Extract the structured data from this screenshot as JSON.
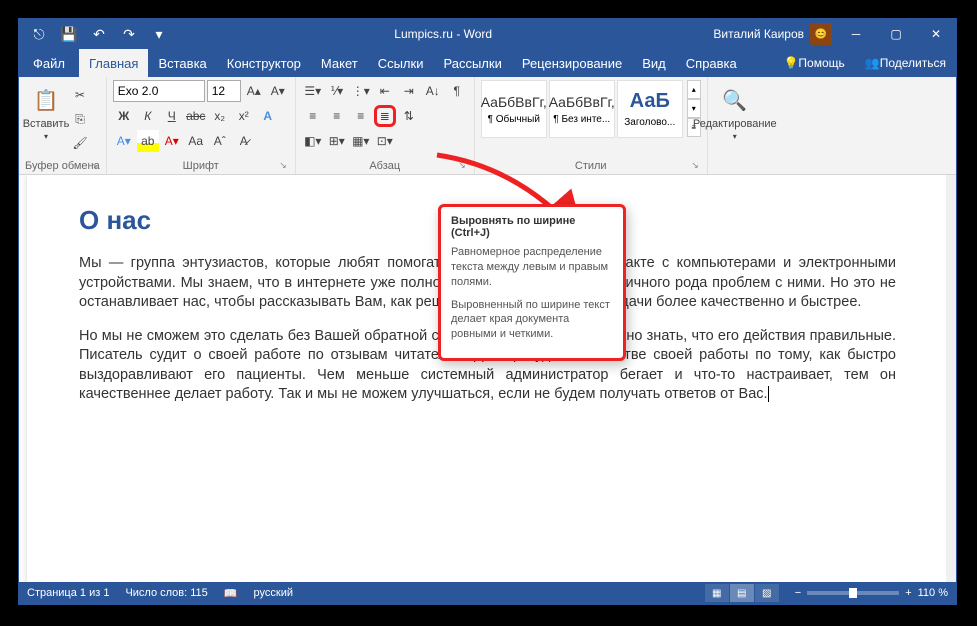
{
  "window": {
    "title": "Lumpics.ru - Word",
    "user": "Виталий Каиров"
  },
  "tabs": {
    "file": "Файл",
    "items": [
      "Главная",
      "Вставка",
      "Конструктор",
      "Макет",
      "Ссылки",
      "Рассылки",
      "Рецензирование",
      "Вид",
      "Справка"
    ],
    "help": "Помощь",
    "share": "Поделиться"
  },
  "ribbon": {
    "clipboard": {
      "label": "Буфер обмена",
      "paste": "Вставить"
    },
    "font": {
      "label": "Шрифт",
      "name": "Exo 2.0",
      "size": "12"
    },
    "paragraph": {
      "label": "Абзац"
    },
    "styles": {
      "label": "Стили",
      "items": [
        {
          "preview": "АаБбВвГг,",
          "name": "¶ Обычный"
        },
        {
          "preview": "АаБбВвГг,",
          "name": "¶ Без инте..."
        },
        {
          "preview": "АаБ",
          "name": "Заголово..."
        }
      ]
    },
    "editing": {
      "label": "Редактирование"
    }
  },
  "tooltip": {
    "title": "Выровнять по ширине (Ctrl+J)",
    "p1": "Равномерное распределение текста между левым и правым полями.",
    "p2": "Выровненный по ширине текст делает края документа ровными и четкими."
  },
  "document": {
    "heading": "О нас",
    "para1": "Мы — группа энтузиастов, которые любят помогать Вам в ежедневном контакте с компьютерами и электронными устройствами. Мы знаем, что в интернете уже полно информации на тему различного рода проблем с ними. Но это не останавливает нас, чтобы рассказывать Вам, как решать многие проблемы и задачи более качественно и быстрее.",
    "para2": "Но мы не сможем это сделать без Вашей обратной связи. Любому человеку важно знать, что его действия правильные. Писатель судит о своей работе по отзывам читателей. Доктор судит о качестве своей работы по тому, как быстро выздоравливают его пациенты. Чем меньше системный администратор бегает и что-то настраивает, тем он качественнее делает работу. Так и мы не можем улучшаться, если не будем получать ответов от Вас."
  },
  "status": {
    "page": "Страница 1 из 1",
    "words": "Число слов: 115",
    "lang": "русский",
    "zoom": "110 %"
  }
}
